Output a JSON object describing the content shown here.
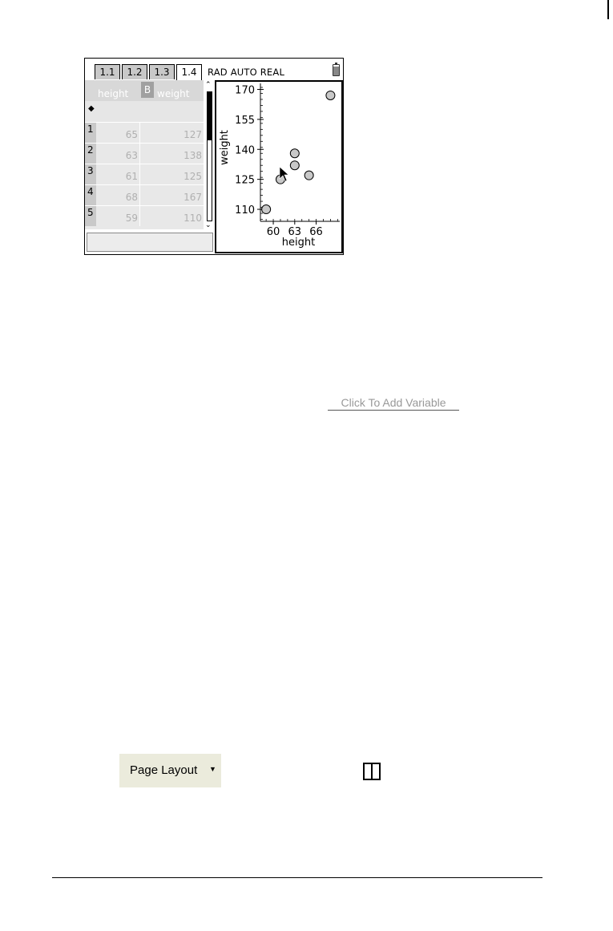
{
  "tabs": [
    {
      "label": "1.1"
    },
    {
      "label": "1.2"
    },
    {
      "label": "1.3"
    },
    {
      "label": "1.4",
      "active": true
    }
  ],
  "status": {
    "modes": "RAD AUTO REAL",
    "battery_icon": "battery-icon"
  },
  "spreadsheet": {
    "columns": [
      {
        "letter": "",
        "name": "height"
      },
      {
        "letter": "B",
        "name": "weight"
      }
    ],
    "formula_marker": "◆",
    "rows": [
      {
        "num": "1",
        "height": "65",
        "weight": "127"
      },
      {
        "num": "2",
        "height": "63",
        "weight": "138"
      },
      {
        "num": "3",
        "height": "61",
        "weight": "125"
      },
      {
        "num": "4",
        "height": "68",
        "weight": "167"
      },
      {
        "num": "5",
        "height": "59",
        "weight": "110"
      }
    ]
  },
  "chart_data": {
    "type": "scatter",
    "xlabel": "height",
    "ylabel": "weight",
    "xticks": [
      "60",
      "63",
      "66"
    ],
    "yticks": [
      "110",
      "125",
      "140",
      "155",
      "170"
    ],
    "xlim": [
      58.2,
      69.3
    ],
    "ylim": [
      104,
      173
    ],
    "points": [
      {
        "x": 59,
        "y": 110
      },
      {
        "x": 61,
        "y": 125
      },
      {
        "x": 63,
        "y": 138
      },
      {
        "x": 63,
        "y": 132
      },
      {
        "x": 65,
        "y": 127
      },
      {
        "x": 68,
        "y": 167
      }
    ],
    "grid": false
  },
  "floating": {
    "add_variable": "Click To Add Variable",
    "page_layout": "Page Layout",
    "split_icon": "split-layout-icon"
  }
}
